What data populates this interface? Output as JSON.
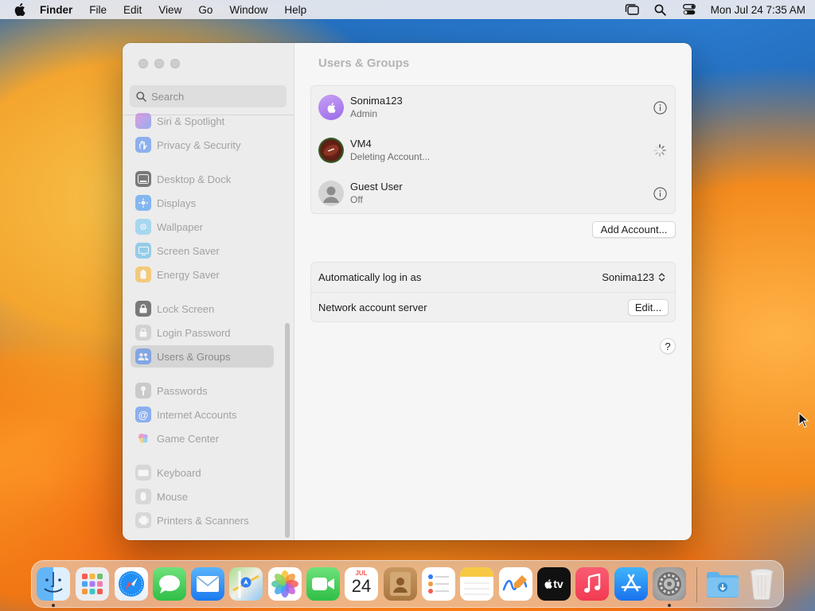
{
  "menubar": {
    "app_name": "Finder",
    "menus": [
      "File",
      "Edit",
      "View",
      "Go",
      "Window",
      "Help"
    ],
    "clock": "Mon Jul 24  7:35 AM",
    "status_icons": [
      "stage-manager-icon",
      "spotlight-search-icon",
      "control-center-icon"
    ]
  },
  "sidebar": {
    "search_placeholder": "Search",
    "items": [
      {
        "label": "Siri & Spotlight",
        "icon": "siri-icon"
      },
      {
        "label": "Privacy & Security",
        "icon": "hand-icon"
      },
      {
        "label": "Desktop & Dock",
        "icon": "dock-icon"
      },
      {
        "label": "Displays",
        "icon": "displays-icon"
      },
      {
        "label": "Wallpaper",
        "icon": "wallpaper-icon"
      },
      {
        "label": "Screen Saver",
        "icon": "screen-saver-icon"
      },
      {
        "label": "Energy Saver",
        "icon": "energy-icon"
      },
      {
        "label": "Lock Screen",
        "icon": "lock-icon"
      },
      {
        "label": "Login Password",
        "icon": "login-password-icon"
      },
      {
        "label": "Users & Groups",
        "icon": "users-icon",
        "selected": true
      },
      {
        "label": "Passwords",
        "icon": "key-icon"
      },
      {
        "label": "Internet Accounts",
        "icon": "at-icon"
      },
      {
        "label": "Game Center",
        "icon": "game-center-icon"
      },
      {
        "label": "Keyboard",
        "icon": "keyboard-icon"
      },
      {
        "label": "Mouse",
        "icon": "mouse-icon"
      },
      {
        "label": "Printers & Scanners",
        "icon": "printer-icon"
      }
    ]
  },
  "content": {
    "title": "Users & Groups",
    "users": [
      {
        "name": "Sonima123",
        "role": "Admin"
      },
      {
        "name": "VM4",
        "role": "Deleting Account..."
      },
      {
        "name": "Guest User",
        "role": "Off"
      }
    ],
    "add_account_label": "Add Account...",
    "auto_login_label": "Automatically log in as",
    "auto_login_value": "Sonima123",
    "network_server_label": "Network account server",
    "edit_label": "Edit...",
    "help_label": "?"
  },
  "dock": {
    "apps": [
      "Finder",
      "Launchpad",
      "Safari",
      "Messages",
      "Mail",
      "Maps",
      "Photos",
      "FaceTime",
      "Calendar",
      "Contacts",
      "Reminders",
      "Notes",
      "Freeform",
      "TV",
      "Music",
      "App Store",
      "System Settings",
      "Downloads",
      "Trash"
    ],
    "calendar_month": "JUL",
    "calendar_day": "24",
    "tv_label": "tv"
  }
}
